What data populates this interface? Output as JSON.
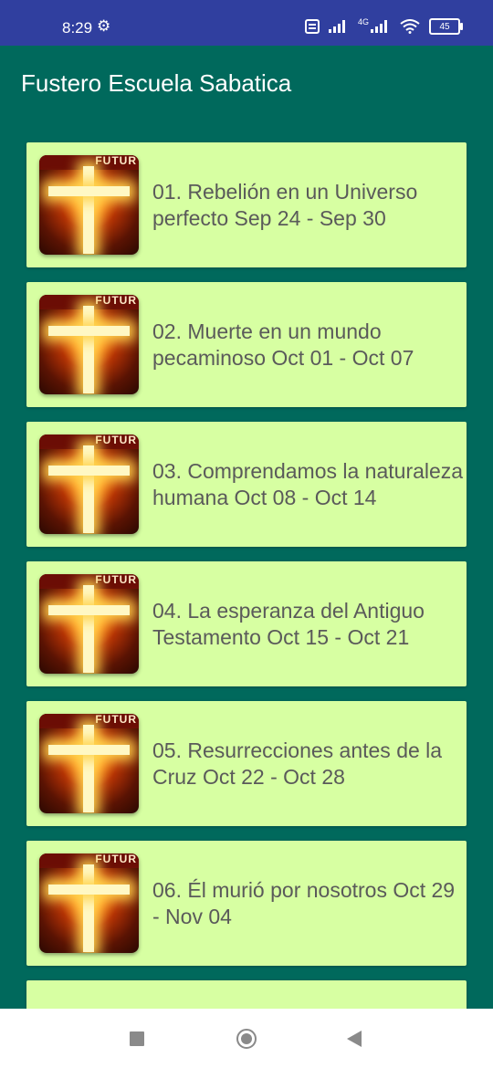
{
  "status_bar": {
    "time": "8:29",
    "network": "4G",
    "battery": "45"
  },
  "app_bar": {
    "title": "Fustero Escuela Sabatica"
  },
  "thumbnail_caption": "FUTUR",
  "lessons": [
    {
      "title": "01. Rebelión en un Universo perfecto Sep 24 - Sep 30"
    },
    {
      "title": "02. Muerte en un mundo pecaminoso Oct 01 - Oct 07"
    },
    {
      "title": "03. Comprendamos la naturaleza humana Oct 08 - Oct 14"
    },
    {
      "title": "04. La esperanza del Antiguo Testamento Oct 15 - Oct 21"
    },
    {
      "title": "05. Resurrecciones antes de la Cruz Oct 22 - Oct 28"
    },
    {
      "title": "06. Él murió por nosotros Oct 29 - Nov 04"
    }
  ],
  "colors": {
    "status_bar": "#303F9F",
    "app_background": "#00695C",
    "card_background": "#D7FFA2",
    "card_text": "#5a5a5a"
  }
}
